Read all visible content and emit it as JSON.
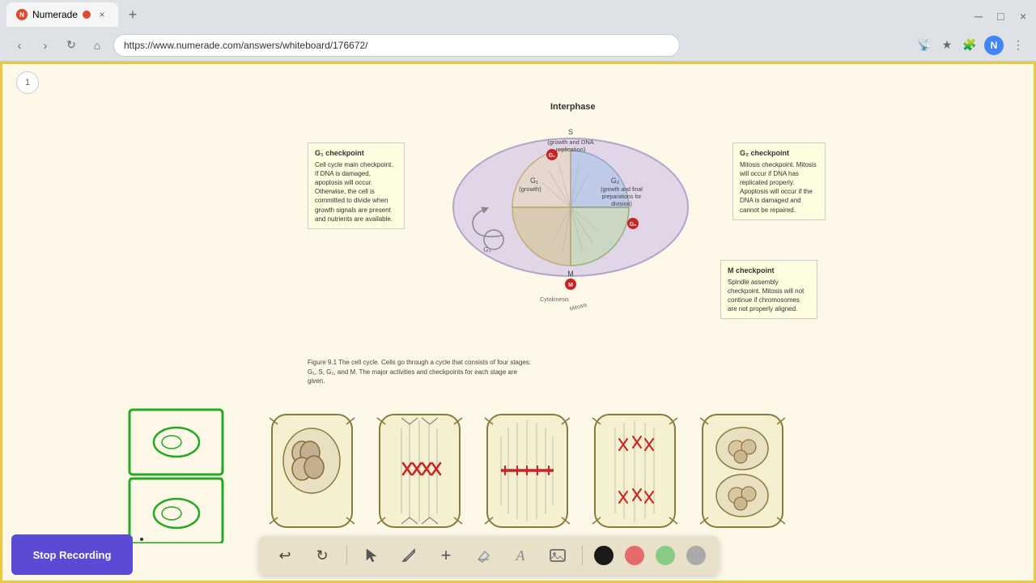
{
  "browser": {
    "tab_label": "Numerade",
    "url": "https://www.numerade.com/answers/whiteboard/176672/",
    "favicon_text": "N",
    "profile_letter": "N"
  },
  "toolbar": {
    "undo_label": "↩",
    "redo_label": "↻",
    "select_label": "▲",
    "pen_label": "✏",
    "add_label": "+",
    "eraser_label": "/",
    "text_label": "A",
    "image_label": "🖼",
    "colors": [
      "#1a1a1a",
      "#e66b6b",
      "#88cc88",
      "#aaaaaa"
    ]
  },
  "stop_recording": {
    "label": "Stop Recording"
  },
  "page": {
    "number": "1"
  },
  "diagram": {
    "interphase_label": "Interphase",
    "g1_box_title": "G₁ checkpoint",
    "g1_box_text": "Cell cycle main checkpoint. If DNA is damaged, apoptosis will occur. Otherwise, the cell is committed to divide when growth signals are present and nutrients are available.",
    "g2_box_title": "G₂ checkpoint",
    "g2_box_text": "Mitosis checkpoint. Mitosis will occur if DNA has replicated properly. Apoptosis will occur if the DNA is damaged and cannot be repaired.",
    "m_box_title": "M checkpoint",
    "m_box_text": "Spindle assembly checkpoint. Mitosis will not continue if chromosomes are not properly aligned.",
    "figure_text": "Figure 9.1  The cell cycle.  Cells go through a cycle that consists of four stages: G₁, S, G₂, and M. The major activities and checkpoints for each stage are given."
  }
}
